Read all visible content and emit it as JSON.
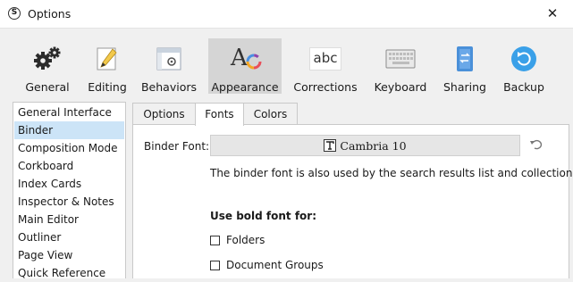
{
  "window": {
    "title": "Options",
    "close_glyph": "✕",
    "app_icon_letter": "S"
  },
  "toolbar": {
    "items": [
      {
        "label": "General",
        "icon": "gears-icon"
      },
      {
        "label": "Editing",
        "icon": "pencil-icon"
      },
      {
        "label": "Behaviors",
        "icon": "window-gear-icon"
      },
      {
        "label": "Appearance",
        "icon": "appearance-icon",
        "selected": true
      },
      {
        "label": "Corrections",
        "icon": "abc-icon"
      },
      {
        "label": "Keyboard",
        "icon": "keyboard-icon"
      },
      {
        "label": "Sharing",
        "icon": "sharing-icon"
      },
      {
        "label": "Backup",
        "icon": "backup-icon"
      }
    ],
    "abc_text": "abc",
    "appearance_text": "A"
  },
  "sidebar": {
    "items": [
      {
        "label": "General Interface"
      },
      {
        "label": "Binder",
        "selected": true
      },
      {
        "label": "Composition Mode"
      },
      {
        "label": "Corkboard"
      },
      {
        "label": "Index Cards"
      },
      {
        "label": "Inspector & Notes"
      },
      {
        "label": "Main Editor"
      },
      {
        "label": "Outliner"
      },
      {
        "label": "Page View"
      },
      {
        "label": "Quick Reference"
      }
    ]
  },
  "tabs": [
    {
      "label": "Options"
    },
    {
      "label": "Fonts",
      "active": true
    },
    {
      "label": "Colors"
    }
  ],
  "fonts_panel": {
    "binder_font_label": "Binder Font:",
    "binder_font_value": "Cambria 10",
    "note": "The binder font is also used by the search results list and collections.",
    "bold_heading": "Use bold font for:",
    "options": [
      {
        "label": "Folders",
        "checked": false
      },
      {
        "label": "Document Groups",
        "checked": false
      }
    ]
  },
  "colors": {
    "selected_toolbar_bg": "#d5d5d5",
    "selected_sidebar_bg": "#cce4f7",
    "font_picker_bg": "#e6e6e6",
    "backup_blue": "#3aa0e8",
    "sharing_blue": "#4a90d9"
  }
}
